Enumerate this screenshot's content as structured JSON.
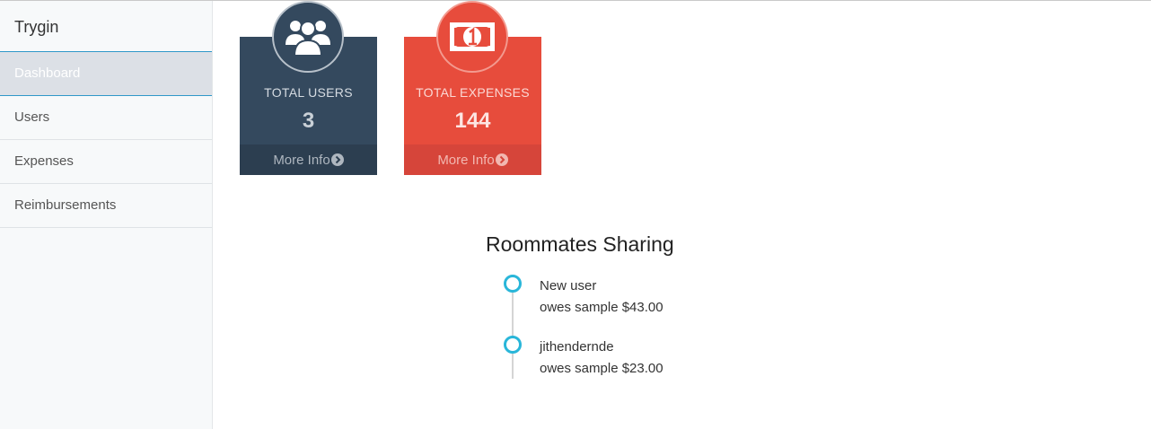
{
  "sidebar": {
    "brand": "Trygin",
    "items": [
      {
        "label": "Dashboard",
        "active": true
      },
      {
        "label": "Users",
        "active": false
      },
      {
        "label": "Expenses",
        "active": false
      },
      {
        "label": "Reimbursements",
        "active": false
      }
    ]
  },
  "cards": [
    {
      "title": "TOTAL USERS",
      "value": "3",
      "footer": "More Info",
      "icon": "users-icon",
      "color": "#34495e"
    },
    {
      "title": "TOTAL EXPENSES",
      "value": "144",
      "footer": "More Info",
      "icon": "money-icon",
      "color": "#e74c3c"
    }
  ],
  "sharing": {
    "title": "Roommates Sharing",
    "items": [
      {
        "name": "New user",
        "text": "owes sample $43.00"
      },
      {
        "name": "jithendernde",
        "text": "owes sample $23.00"
      }
    ]
  },
  "colors": {
    "timeline_dot": "#29b6d9",
    "active_nav_border": "#2f98c9"
  }
}
